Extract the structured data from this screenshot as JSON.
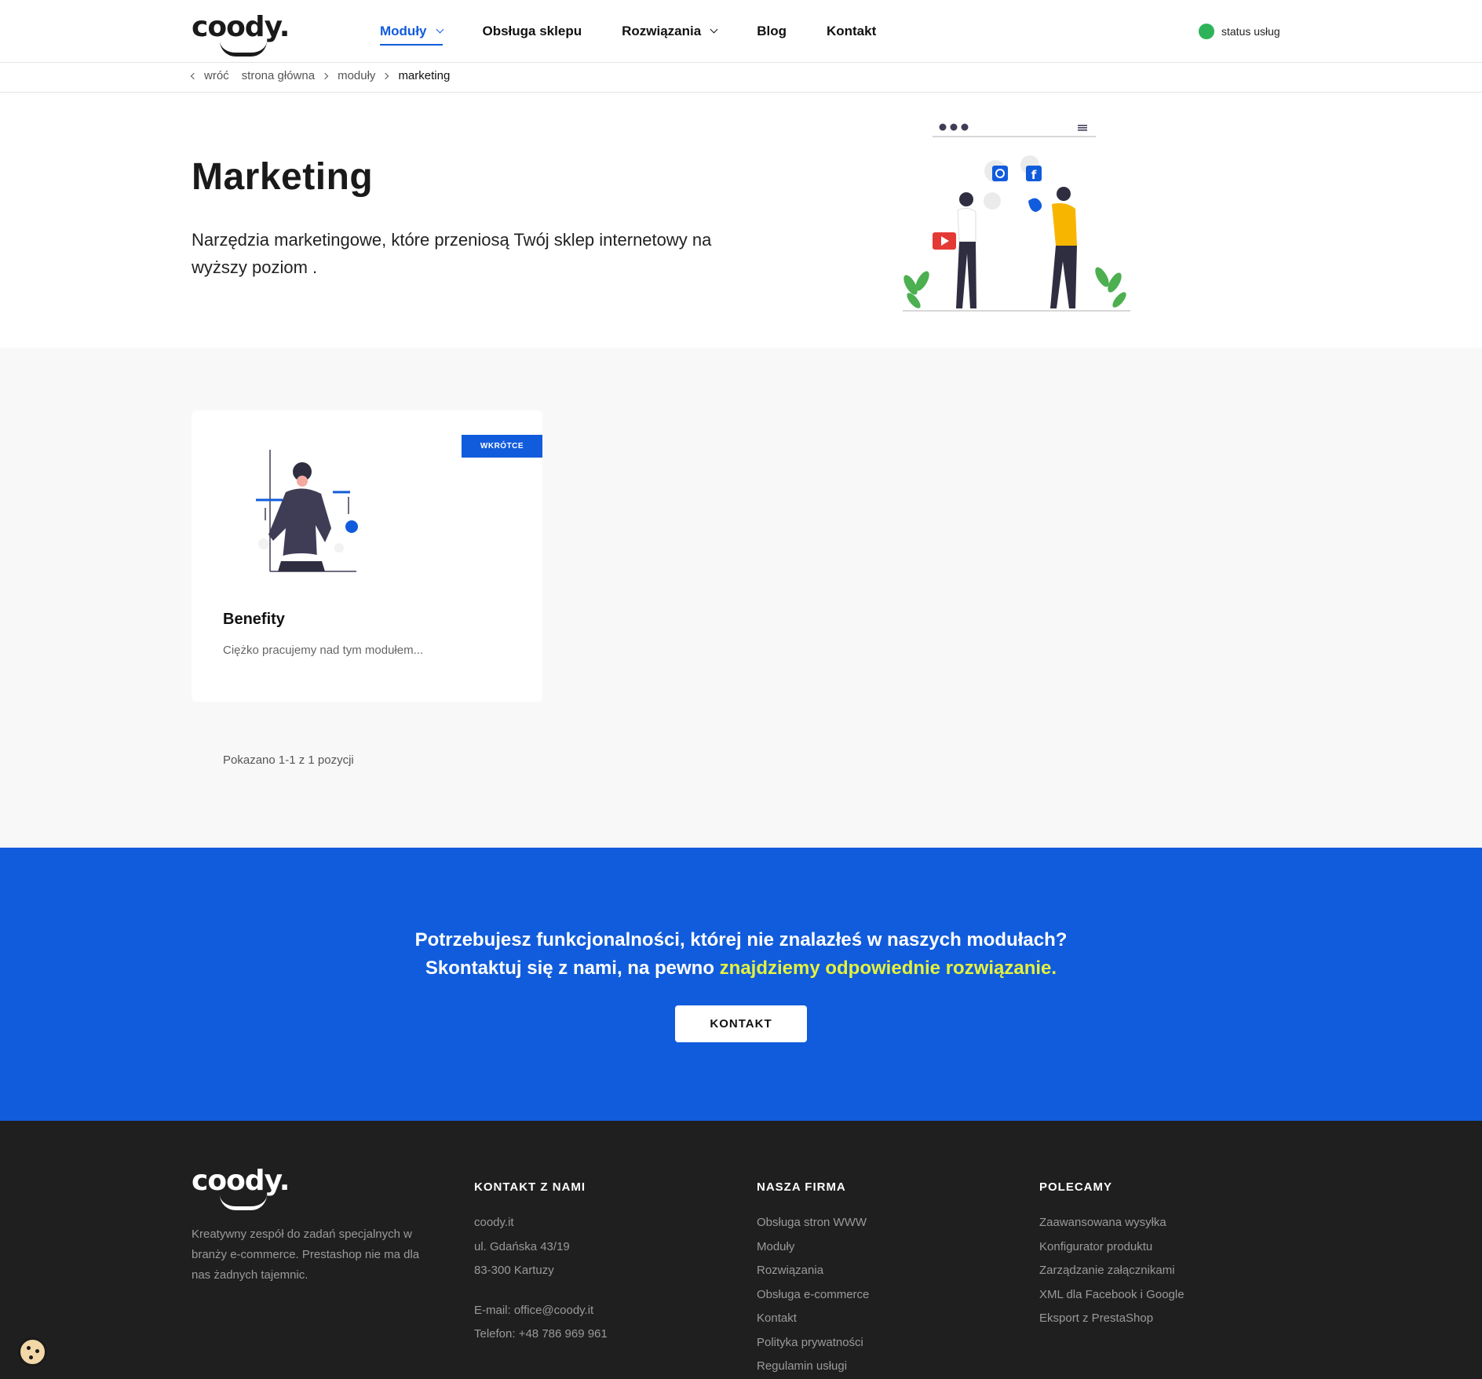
{
  "brand": {
    "logo_text": "coody.",
    "primary_color": "#115cdc",
    "highlight_color": "#e5f23c",
    "status_color": "#2fb35a"
  },
  "header": {
    "nav": [
      {
        "label": "Moduły",
        "has_dropdown": true,
        "active": true
      },
      {
        "label": "Obsługa sklepu",
        "has_dropdown": false
      },
      {
        "label": "Rozwiązania",
        "has_dropdown": true
      },
      {
        "label": "Blog",
        "has_dropdown": false
      },
      {
        "label": "Kontakt",
        "has_dropdown": false
      }
    ],
    "status_label": "status usług"
  },
  "breadcrumb": {
    "back": "wróć",
    "home": "strona główna",
    "modules": "moduły",
    "current": "marketing"
  },
  "hero": {
    "title": "Marketing",
    "text": "Narzędzia marketingowe, które przeniosą Twój sklep internetowy na wyższy poziom ."
  },
  "listing": {
    "cards": [
      {
        "badge": "WKRÓTCE",
        "title": "Benefity",
        "description": "Ciężko pracujemy nad tym modułem..."
      }
    ],
    "pagination_info": "Pokazano 1-1 z 1 pozycji"
  },
  "cta": {
    "line1": "Potrzebujesz funkcjonalności, której nie znalazłeś w naszych modułach?",
    "line2_start": "Skontaktuj się z nami, na pewno ",
    "line2_highlight": "znajdziemy odpowiednie rozwiązanie.",
    "button": "KONTAKT"
  },
  "footer": {
    "logo_text": "coody.",
    "about": "Kreatywny zespół do zadań specjalnych w branży e-commerce. Prestashop nie ma dla nas żadnych tajemnic.",
    "contact": {
      "heading": "KONTAKT Z NAMI",
      "items": [
        "coody.it",
        "ul. Gdańska 43/19",
        "83-300 Kartuzy",
        "E-mail: office@coody.it",
        "Telefon: +48 786 969 961"
      ]
    },
    "company": {
      "heading": "NASZA FIRMA",
      "items": [
        "Obsługa stron WWW",
        "Moduły",
        "Rozwiązania",
        "Obsługa e-commerce",
        "Kontakt",
        "Polityka prywatności",
        "Regulamin usługi"
      ]
    },
    "recommended": {
      "heading": "POLECAMY",
      "items": [
        "Zaawansowana wysyłka",
        "Konfigurator produktu",
        "Zarządzanie załącznikami",
        "XML dla Facebook i Google",
        "Eksport z PrestaShop"
      ]
    }
  }
}
